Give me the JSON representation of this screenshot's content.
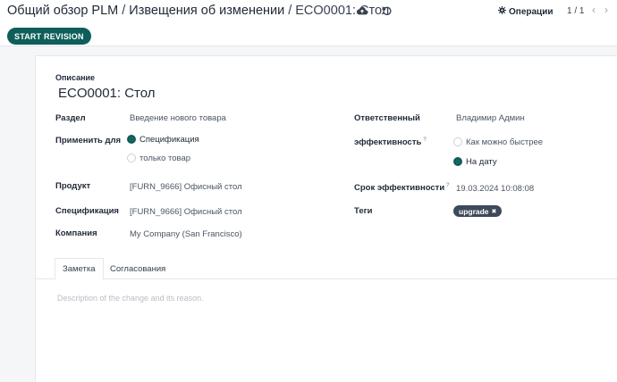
{
  "breadcrumb": {
    "root": "Общий обзор PLM",
    "middle": "Извещения об изменении",
    "current": "ECO0001: Стол"
  },
  "toolbar": {
    "operations_label": "Операции",
    "pager": "1 / 1",
    "start_revision_label": "START REVISION"
  },
  "form": {
    "description_label": "Описание",
    "title": "ECO0001: Стол",
    "section_label": "Раздел",
    "section_value": "Введение нового товара",
    "apply_label": "Применить для",
    "apply_options": [
      "Спецификация",
      "только товар"
    ],
    "product_label": "Продукт",
    "product_value": "[FURN_9666] Офисный стол",
    "bom_label": "Спецификация",
    "bom_value": "[FURN_9666] Офисный стол",
    "company_label": "Компания",
    "company_value": "My Company (San Francisco)",
    "responsible_label": "Ответственный",
    "responsible_value": "Владимир Админ",
    "effectivity_label": "эффективность",
    "effectivity_help": "?",
    "effectivity_options": [
      "Как можно быстрее",
      "На дату"
    ],
    "effective_date_label": "Срок эффективности",
    "effective_date_help": "?",
    "effective_date_value": "19.03.2024 10:08:08",
    "tags_label": "Теги",
    "tag_value": "upgrade",
    "tag_remove": "✖"
  },
  "tabs": [
    "Заметка",
    "Согласования"
  ],
  "note_placeholder": "Description of the change and its reason.",
  "colors": {
    "primary": "#0f5e5a",
    "tag_bg": "#3d4a5c"
  }
}
